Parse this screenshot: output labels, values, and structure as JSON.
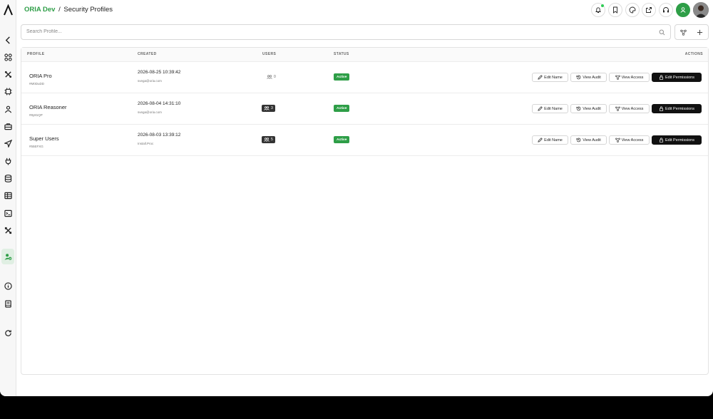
{
  "header": {
    "brand": "ORIA Dev",
    "separator": "/",
    "page_title": "Security Profiles"
  },
  "header_icons": [
    "bell-icon",
    "bookmark-icon",
    "palette-icon",
    "share-icon",
    "headset-icon",
    "user-badge-icon",
    "avatar"
  ],
  "sidebar": {
    "items": [
      {
        "name": "collapse",
        "icon": "chevron-left-icon"
      },
      {
        "name": "dashboard",
        "icon": "grid-icon"
      },
      {
        "name": "tools",
        "icon": "tools-icon"
      },
      {
        "name": "chip",
        "icon": "chip-icon"
      },
      {
        "name": "agents",
        "icon": "agent-icon"
      },
      {
        "name": "toolbox",
        "icon": "briefcase-icon"
      },
      {
        "name": "deploy",
        "icon": "send-icon"
      },
      {
        "name": "plugins",
        "icon": "plug-icon"
      },
      {
        "name": "database",
        "icon": "database-icon"
      },
      {
        "name": "tables",
        "icon": "table-icon"
      },
      {
        "name": "terminal",
        "icon": "terminal-icon"
      },
      {
        "name": "settings",
        "icon": "wrench-icon"
      },
      {
        "name": "security-profiles",
        "icon": "user-shield-icon",
        "active": true
      },
      {
        "name": "info",
        "icon": "info-icon"
      },
      {
        "name": "docs",
        "icon": "book-icon"
      },
      {
        "name": "refresh",
        "icon": "refresh-icon"
      }
    ]
  },
  "search": {
    "placeholder": "Search Profile...",
    "value": ""
  },
  "table": {
    "columns": [
      "PROFILE",
      "CREATED",
      "USERS",
      "STATUS",
      "ACTIONS"
    ],
    "rows": [
      {
        "name": "ORIA Pro",
        "id": "#M0DuDD",
        "created": "2026-08-25 10:39:42",
        "created_by": "svega@oria.com",
        "users": "0",
        "users_style": "zero",
        "status": "Active"
      },
      {
        "name": "ORIA Reasoner",
        "id": "#8y81QP",
        "created": "2026-08-04 14:31:10",
        "created_by": "svega@oria.com",
        "users": "3",
        "users_style": "dark",
        "status": "Active"
      },
      {
        "name": "Super Users",
        "id": "#55EFXG",
        "created": "2026-08-03 13:39:12",
        "created_by": "Install.Proc",
        "users": "5",
        "users_style": "dark",
        "status": "Active"
      }
    ],
    "actions": {
      "edit_name": "Edit Name",
      "view_audit": "View Audit",
      "view_access": "View Access",
      "edit_permissions": "Edit Permissions"
    }
  },
  "colors": {
    "brand": "#2e9e47",
    "status_active": "#2e9e47",
    "primary_button": "#111111"
  }
}
